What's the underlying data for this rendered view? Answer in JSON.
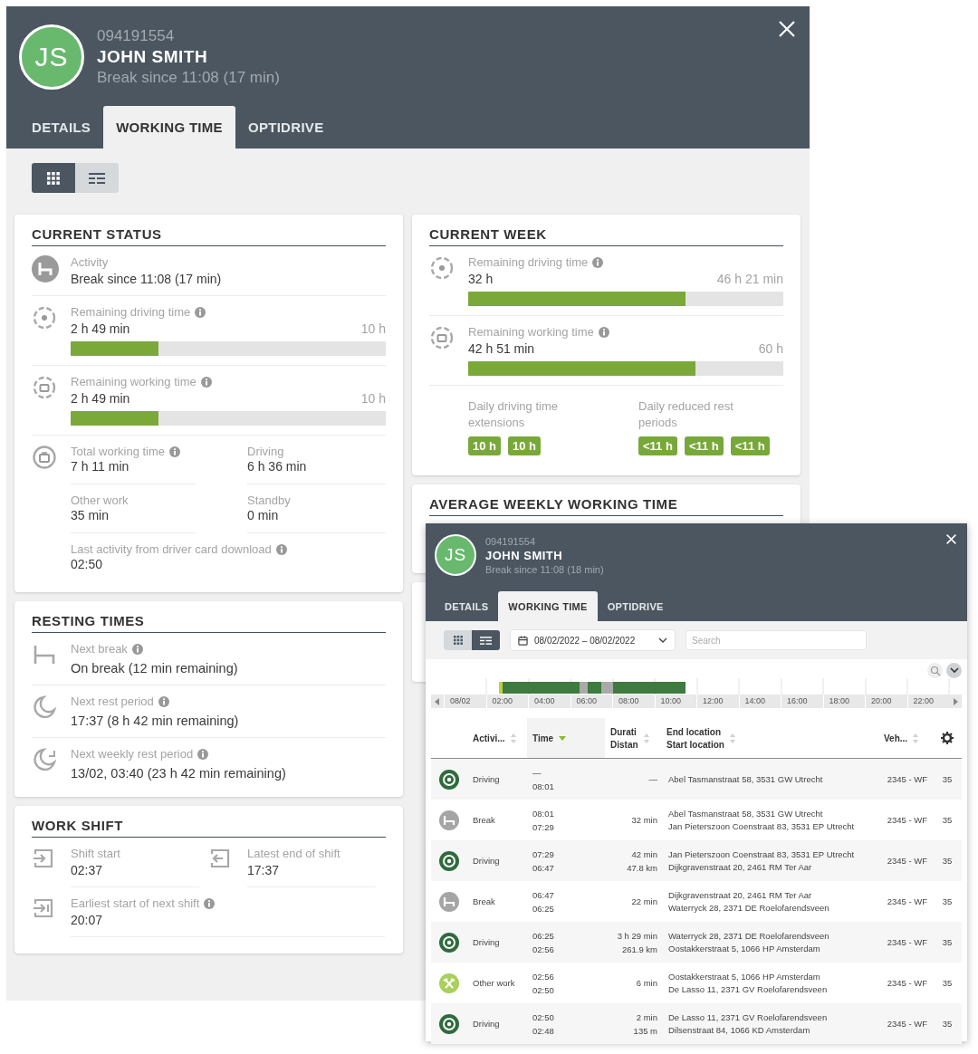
{
  "driver": {
    "initials": "JS",
    "id": "094191554",
    "name": "JOHN SMITH",
    "status": "Break since 11:08 (17 min)"
  },
  "tabs": [
    {
      "label": "DETAILS",
      "selected": false
    },
    {
      "label": "WORKING TIME",
      "selected": true
    },
    {
      "label": "OPTIDRIVE",
      "selected": false
    }
  ],
  "view_toggle": [
    {
      "kind": "grid",
      "selected": true
    },
    {
      "kind": "list",
      "selected": false
    }
  ],
  "current_status": {
    "title": "CURRENT STATUS",
    "activity": {
      "kind": "break",
      "label": "Activity",
      "info": false,
      "value": "Break since 11:08 (17 min)"
    },
    "meters": [
      {
        "kind": "driving",
        "label": "Remaining driving time",
        "info": true,
        "value": "2 h 49 min",
        "max": "10 h",
        "level": 0.28
      },
      {
        "kind": "working",
        "label": "Remaining working time",
        "info": true,
        "value": "2 h 49 min",
        "max": "10 h",
        "level": 0.28
      }
    ],
    "totals": [
      {
        "label": "Total working time",
        "info": true,
        "value": "7 h 11 min"
      },
      {
        "label": "Driving",
        "info": false,
        "value": "6 h 36 min"
      },
      {
        "label": "Other work",
        "info": false,
        "value": "35 min"
      },
      {
        "label": "Standby",
        "info": false,
        "value": "0 min"
      }
    ],
    "last_activity": {
      "label": "Last activity from driver card download",
      "info": true,
      "value": "02:50"
    }
  },
  "resting_times": {
    "title": "RESTING TIMES",
    "items": [
      {
        "kind": "break",
        "label": "Next break",
        "info": true,
        "value": "On break (12 min remaining)"
      },
      {
        "kind": "rest",
        "label": "Next rest period",
        "info": true,
        "value": "17:37 (8 h 42 min remaining)"
      },
      {
        "kind": "weekly_rest",
        "label": "Next weekly rest period",
        "info": true,
        "value": "13/02, 03:40 (23 h 42 min remaining)"
      }
    ]
  },
  "work_shift": {
    "title": "WORK SHIFT",
    "items": [
      {
        "kind": "start",
        "label": "Shift start",
        "info": false,
        "value": "02:37"
      },
      {
        "kind": "end",
        "label": "Latest end of shift",
        "info": false,
        "value": "17:37"
      },
      {
        "kind": "next",
        "label": "Earliest start of next shift",
        "info": true,
        "value": "20:07"
      }
    ]
  },
  "current_week": {
    "title": "CURRENT WEEK",
    "meters": [
      {
        "kind": "driving",
        "label": "Remaining driving time",
        "info": true,
        "value": "32 h",
        "max": "46 h 21 min",
        "level": 0.69
      },
      {
        "kind": "working",
        "label": "Remaining working time",
        "info": true,
        "value": "42 h 51 min",
        "max": "60 h",
        "level": 0.72
      }
    ],
    "extensions": {
      "label": "Daily driving time extensions",
      "tags": [
        "10 h",
        "10 h"
      ]
    },
    "reduced_rest": {
      "label": "Daily reduced rest periods",
      "tags": [
        "<11 h",
        "<11 h",
        "<11 h"
      ]
    }
  },
  "average_weekly": {
    "title": "AVERAGE WEEKLY WORKING TIME"
  },
  "popup": {
    "driver": {
      "initials": "JS",
      "id": "094191554",
      "name": "JOHN SMITH",
      "status": "Break since 11:08 (18 min)"
    },
    "tabs": [
      {
        "label": "DETAILS",
        "selected": false
      },
      {
        "label": "WORKING TIME",
        "selected": true
      },
      {
        "label": "OPTIDRIVE",
        "selected": false
      }
    ],
    "view_toggle": [
      {
        "kind": "grid",
        "selected": false
      },
      {
        "kind": "list",
        "selected": true
      }
    ],
    "date_range": "08/02/2022 – 08/02/2022",
    "search": {
      "placeholder": "Search"
    },
    "timeline": {
      "labels": [
        "08/02",
        "02:00",
        "04:00",
        "06:00",
        "08:00",
        "10:00",
        "12:00",
        "14:00",
        "16:00",
        "18:00",
        "20:00",
        "22:00"
      ]
    },
    "table": {
      "columns": [
        {
          "labels": [
            "Activi..."
          ],
          "sorted": false
        },
        {
          "labels": [
            "Time"
          ],
          "sorted": true
        },
        {
          "labels": [
            "Durati",
            "Distan"
          ],
          "sorted": false
        },
        {
          "labels": [
            "End location",
            "Start location"
          ],
          "sorted": false
        },
        {
          "labels": [
            "Veh..."
          ],
          "sorted": false
        }
      ],
      "rows": [
        {
          "kind": "driving",
          "activity": "Driving",
          "times": [
            "—",
            "08:01"
          ],
          "amounts": [
            "—"
          ],
          "locations": [
            "Abel Tasmanstraat 58, 3531 GW Utrecht"
          ],
          "vehicle": "2345 - WF",
          "column_7": "35"
        },
        {
          "kind": "break",
          "activity": "Break",
          "times": [
            "08:01",
            "07:29"
          ],
          "amounts": [
            "32 min"
          ],
          "locations": [
            "Abel Tasmanstraat 58, 3531 GW Utrecht",
            "Jan Pieterszoon Coenstraat 83, 3531 EP Utrecht"
          ],
          "vehicle": "2345 - WF",
          "column_7": "35"
        },
        {
          "kind": "driving",
          "activity": "Driving",
          "times": [
            "07:29",
            "06:47"
          ],
          "amounts": [
            "42 min",
            "47.8 km"
          ],
          "locations": [
            "Jan Pieterszoon Coenstraat 83, 3531 EP Utrecht",
            "Dijkgravenstraat 20, 2461 RM Ter Aar"
          ],
          "vehicle": "2345 - WF",
          "column_7": "35"
        },
        {
          "kind": "break",
          "activity": "Break",
          "times": [
            "06:47",
            "06:25"
          ],
          "amounts": [
            "22 min"
          ],
          "locations": [
            "Dijkgravenstraat 20, 2461 RM Ter Aar",
            "Waterryck 28, 2371 DE Roelofarendsveen"
          ],
          "vehicle": "2345 - WF",
          "column_7": "35"
        },
        {
          "kind": "driving",
          "activity": "Driving",
          "times": [
            "06:25",
            "02:56"
          ],
          "amounts": [
            "3 h 29 min",
            "261.9 km"
          ],
          "locations": [
            "Waterryck 28, 2371 DE Roelofarendsveen",
            "Oostakkerstraat 5, 1066 HP Amsterdam"
          ],
          "vehicle": "2345 - WF",
          "column_7": "35"
        },
        {
          "kind": "other_work",
          "activity": "Other work",
          "times": [
            "02:56",
            "02:50"
          ],
          "amounts": [
            "6 min"
          ],
          "locations": [
            "Oostakkerstraat 5, 1066 HP Amsterdam",
            "De Lasso 11, 2371 GV Roelofarendsveen"
          ],
          "vehicle": "2345 - WF",
          "column_7": "35"
        },
        {
          "kind": "driving",
          "activity": "Driving",
          "times": [
            "02:50",
            "02:48"
          ],
          "amounts": [
            "2 min",
            "135 m"
          ],
          "locations": [
            "De Lasso 11, 2371 GV Roelofarendsveen",
            "Dilsenstraat 84, 1066 KD Amsterdam"
          ],
          "vehicle": "2345 - WF",
          "column_7": "35"
        }
      ]
    }
  }
}
